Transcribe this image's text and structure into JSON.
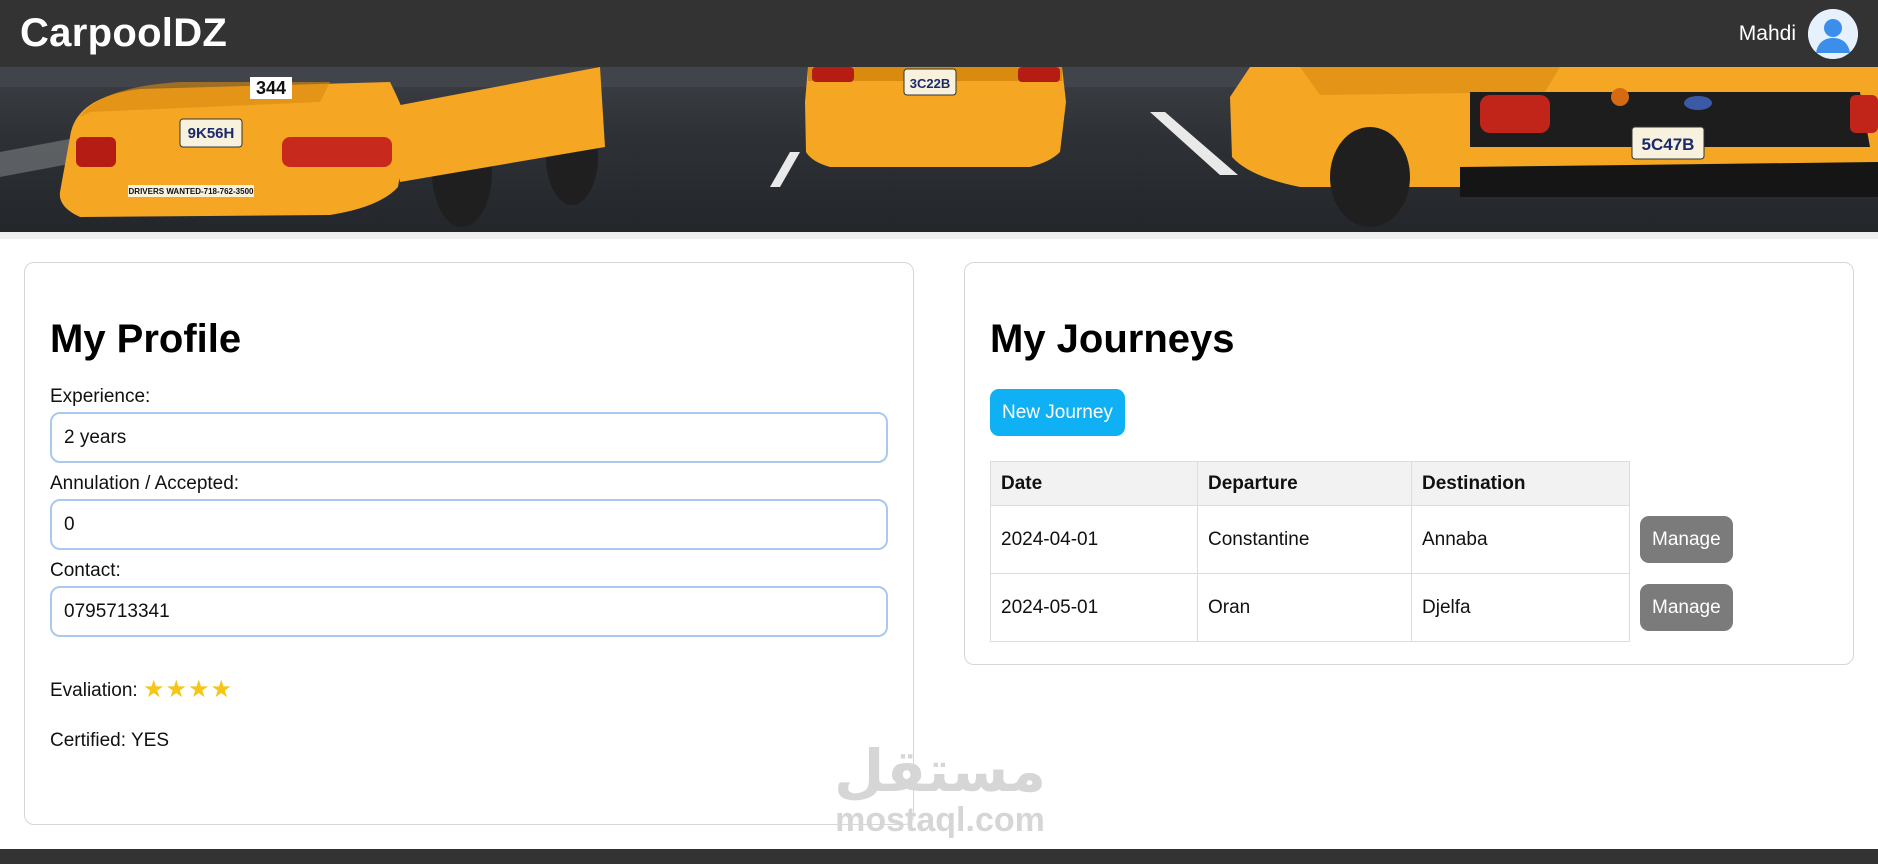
{
  "header": {
    "brand": "CarpoolDZ",
    "user_name": "Mahdi",
    "avatar_icon": "user-avatar-icon"
  },
  "banner": {
    "icon": "taxi-banner-image",
    "plates": [
      "344",
      "9K56H",
      "3C22B",
      "5C47B"
    ],
    "decal": "DRIVERS WANTED-718-762-3500"
  },
  "profile": {
    "title": "My Profile",
    "fields": [
      {
        "label": "Experience:",
        "value": "2 years"
      },
      {
        "label": "Annulation / Accepted:",
        "value": "0"
      },
      {
        "label": "Contact:",
        "value": "0795713341"
      }
    ],
    "evaluation_label": "Evaliation:",
    "evaluation_stars": "★★★★",
    "evaluation_rating": 4,
    "certified_label": "Certified:",
    "certified_value": "YES"
  },
  "journeys": {
    "title": "My Journeys",
    "new_button": "New Journey",
    "columns": [
      "Date",
      "Departure",
      "Destination"
    ],
    "rows": [
      {
        "date": "2024-04-01",
        "departure": "Constantine",
        "destination": "Annaba",
        "action": "Manage"
      },
      {
        "date": "2024-05-01",
        "departure": "Oran",
        "destination": "Djelfa",
        "action": "Manage"
      }
    ]
  },
  "watermark": {
    "arabic": "مستقل",
    "latin": "mostaql.com"
  },
  "colors": {
    "topbar": "#333333",
    "accent": "#0fb0f4",
    "manage_button": "#7b7b7b",
    "input_border": "#a9c9ee",
    "star": "#f5c518",
    "taxi": "#f5a623"
  }
}
